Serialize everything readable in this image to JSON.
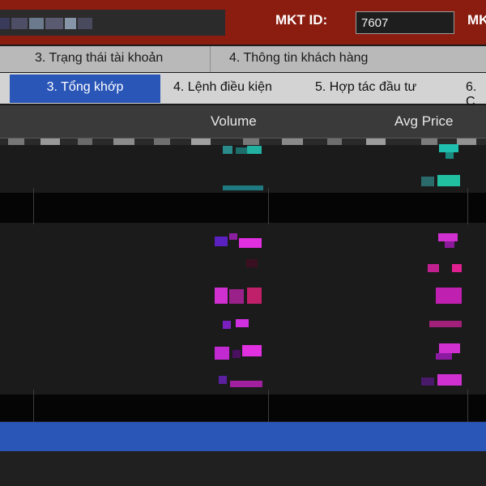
{
  "header": {
    "mkt_id_label": "MKT ID:",
    "mkt_id_value": "7607",
    "mkt_id_label_cut": "MK"
  },
  "tabs_row1": [
    {
      "label": "3. Trạng thái tài khoản"
    },
    {
      "label": "4. Thông tin khách hàng"
    }
  ],
  "tabs_row2": [
    {
      "label": "3. Tổng khớp",
      "active": true
    },
    {
      "label": "4. Lệnh điều kiện"
    },
    {
      "label": "5. Hợp tác đầu tư"
    },
    {
      "label": "6. C"
    }
  ],
  "columns": [
    {
      "label": "Volume"
    },
    {
      "label": "Avg Price"
    }
  ],
  "colors": {
    "header_bg": "#8a1c10",
    "active_tab": "#2a56b8",
    "cell_teal": "#20c0b0",
    "cell_magenta": "#e030e0"
  }
}
